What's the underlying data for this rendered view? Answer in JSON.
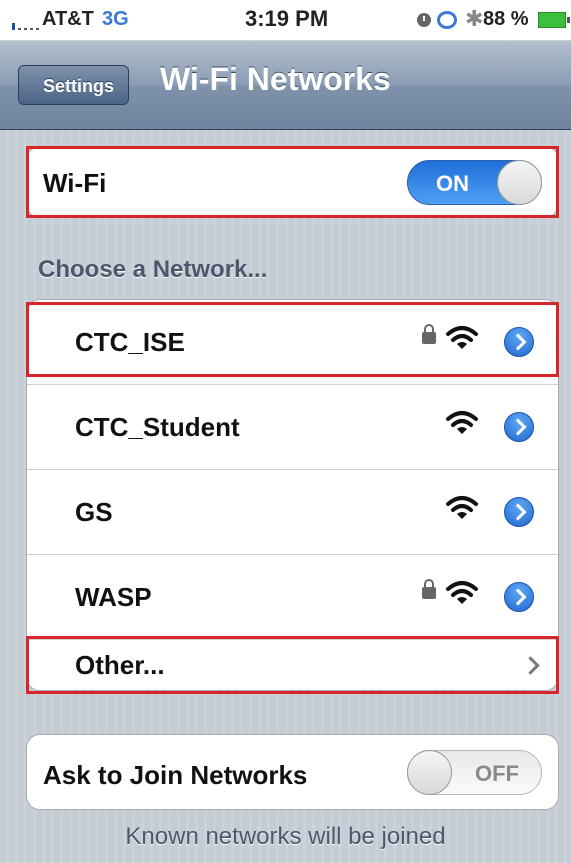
{
  "status_bar": {
    "carrier": "AT&T",
    "network": "3G",
    "time": "3:19 PM",
    "battery": "88 %",
    "icons": [
      "signal-icon",
      "clock-icon",
      "rotation-lock-icon",
      "bluetooth-icon",
      "battery-icon"
    ]
  },
  "nav": {
    "back_label": "Settings",
    "title": "Wi-Fi Networks"
  },
  "wifi": {
    "label": "Wi-Fi",
    "toggle": "ON"
  },
  "networks_header": "Choose a Network...",
  "networks": [
    {
      "name": "CTC_ISE",
      "locked": true
    },
    {
      "name": "CTC_Student",
      "locked": false
    },
    {
      "name": "GS",
      "locked": false
    },
    {
      "name": "WASP",
      "locked": true
    }
  ],
  "other_label": "Other...",
  "ask": {
    "label": "Ask to Join Networks",
    "toggle": "OFF"
  },
  "footer_text": "Known networks will be joined",
  "colors": {
    "highlight": "#d8242b",
    "accent": "#1f6fd8"
  }
}
